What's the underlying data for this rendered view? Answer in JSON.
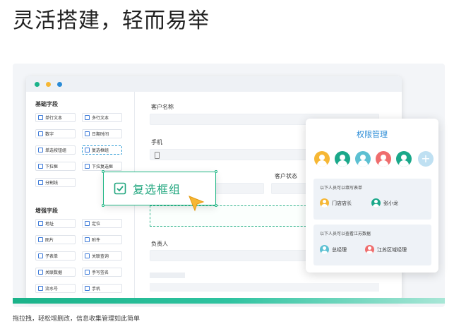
{
  "headline": "灵活搭建，轻而易举",
  "caption": "拖拉拽，轻松增删改，信息收集管理如此简单",
  "colors": {
    "accent": "#20b785",
    "blue": "#2a8bd6",
    "dot_green": "#1bb38a",
    "dot_yellow": "#f6b734",
    "dot_blue": "#2a8bd6"
  },
  "left_panel": {
    "basic_title": "基础字段",
    "basic_fields": [
      {
        "label": "单行文本",
        "icon": "single-line-text-icon"
      },
      {
        "label": "多行文本",
        "icon": "multi-line-text-icon"
      },
      {
        "label": "数字",
        "icon": "number-icon"
      },
      {
        "label": "日期时间",
        "icon": "datetime-icon"
      },
      {
        "label": "单选按钮组",
        "icon": "radio-icon"
      },
      {
        "label": "复选框组",
        "icon": "checkbox-icon"
      },
      {
        "label": "下拉框",
        "icon": "dropdown-icon"
      },
      {
        "label": "下拉复选框",
        "icon": "dropdown-checkbox-icon"
      },
      {
        "label": "分割线",
        "icon": "divider-icon"
      }
    ],
    "enhanced_title": "增强字段",
    "enhanced_fields": [
      {
        "label": "地址",
        "icon": "location-icon"
      },
      {
        "label": "定位",
        "icon": "positioning-icon"
      },
      {
        "label": "图片",
        "icon": "image-icon"
      },
      {
        "label": "附件",
        "icon": "attachment-icon"
      },
      {
        "label": "子表单",
        "icon": "subform-icon"
      },
      {
        "label": "关联查询",
        "icon": "linked-query-icon"
      },
      {
        "label": "关联数据",
        "icon": "linked-data-icon"
      },
      {
        "label": "手写签名",
        "icon": "signature-icon"
      },
      {
        "label": "流水号",
        "icon": "serial-number-icon"
      },
      {
        "label": "手机",
        "icon": "phone-icon"
      }
    ]
  },
  "form": {
    "customer_name": "客户名称",
    "phone": "手机",
    "customer_status": "客户状态",
    "owner": "负责人"
  },
  "drag_card": {
    "label": "复选框组"
  },
  "permission": {
    "title": "权限管理",
    "avatars": [
      {
        "color": "#f6b734"
      },
      {
        "color": "#1aa88a"
      },
      {
        "color": "#5cc0d2"
      },
      {
        "color": "#ef6d6d"
      },
      {
        "color": "#1aa88a"
      }
    ],
    "add_color": "#bfe0f2",
    "fill_title": "以下人员可以填写表单",
    "fill_people": [
      {
        "name": "门店店长",
        "color": "#f6b734"
      },
      {
        "name": "张小龙",
        "color": "#1aa88a"
      }
    ],
    "view_title": "以下人员可以查看江苏数据",
    "view_people": [
      {
        "name": "总经理",
        "color": "#5cc0d2"
      },
      {
        "name": "江苏区域经理",
        "color": "#ef6d6d"
      }
    ]
  }
}
